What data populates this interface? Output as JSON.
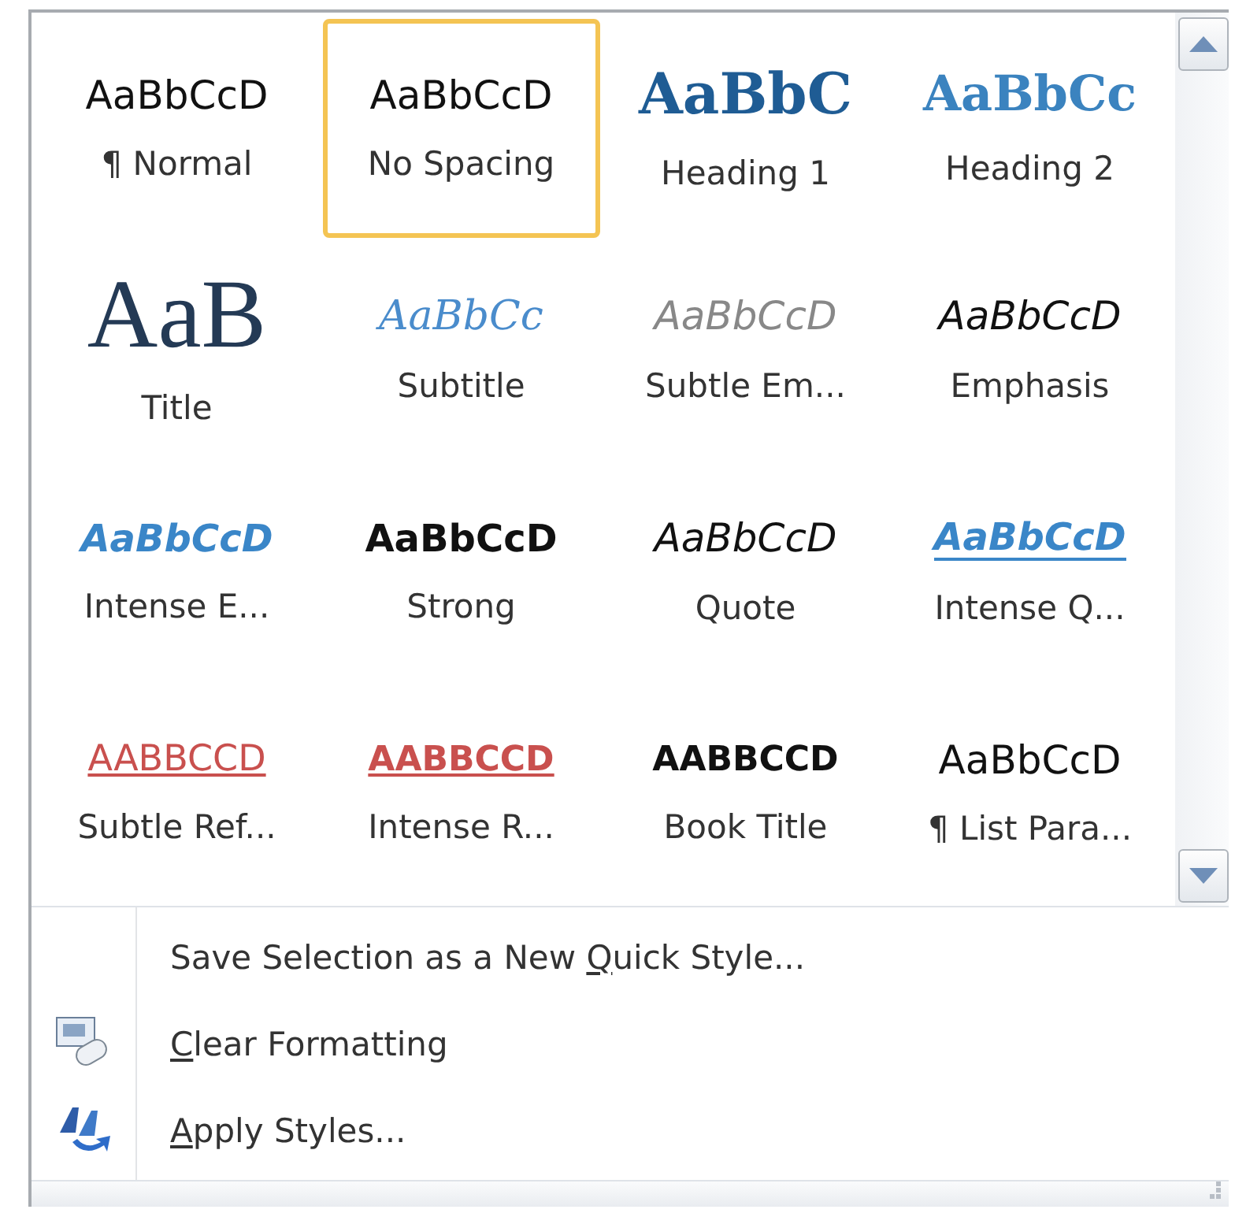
{
  "gallery": {
    "styles": [
      {
        "sample": "AaBbCcD",
        "label": "¶ Normal",
        "kind": "normal",
        "selected": false
      },
      {
        "sample": "AaBbCcD",
        "label": "No Spacing",
        "kind": "normal",
        "selected": true
      },
      {
        "sample": "AaBbC",
        "label": "Heading 1",
        "kind": "heading1",
        "selected": false
      },
      {
        "sample": "AaBbCc",
        "label": "Heading 2",
        "kind": "heading2",
        "selected": false
      },
      {
        "sample": "AaB",
        "label": "Title",
        "kind": "title",
        "selected": false
      },
      {
        "sample": "AaBbCc",
        "label": "Subtitle",
        "kind": "subtitle",
        "selected": false
      },
      {
        "sample": "AaBbCcD",
        "label": "Subtle Em...",
        "kind": "subtle-emphasis",
        "selected": false
      },
      {
        "sample": "AaBbCcD",
        "label": "Emphasis",
        "kind": "emphasis",
        "selected": false
      },
      {
        "sample": "AaBbCcD",
        "label": "Intense E...",
        "kind": "intense-emphasis",
        "selected": false
      },
      {
        "sample": "AaBbCcD",
        "label": "Strong",
        "kind": "strong",
        "selected": false
      },
      {
        "sample": "AaBbCcD",
        "label": "Quote",
        "kind": "quote",
        "selected": false
      },
      {
        "sample": "AaBbCcD",
        "label": "Intense Q...",
        "kind": "intense-quote",
        "selected": false
      },
      {
        "sample": "AABBCCD",
        "label": "Subtle Ref...",
        "kind": "subtle-reference",
        "selected": false
      },
      {
        "sample": "AABBCCD",
        "label": "Intense R...",
        "kind": "intense-reference",
        "selected": false
      },
      {
        "sample": "AABBCCD",
        "label": "Book Title",
        "kind": "book-title",
        "selected": false
      },
      {
        "sample": "AaBbCcD",
        "label": "¶ List Para...",
        "kind": "normal",
        "selected": false
      }
    ]
  },
  "menu": [
    {
      "before": "Save Selection as a New ",
      "key": "Q",
      "after": "uick Style...",
      "kind": "none"
    },
    {
      "key": "C",
      "after": "lear Formatting",
      "kind": "eraser"
    },
    {
      "key": "A",
      "after": "pply Styles...",
      "kind": "apply"
    }
  ]
}
